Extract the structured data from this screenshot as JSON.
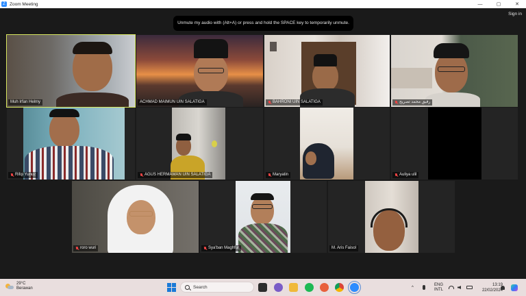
{
  "window": {
    "app_title": "Zoom Meeting",
    "minimize": "—",
    "maximize": "▢",
    "close": "✕"
  },
  "header": {
    "sign_in": "Sign in"
  },
  "notification": {
    "message": "Unmute my audio with (Alt+A) or press and hold the SPACE key to temporarily unmute."
  },
  "participants": [
    {
      "name": "Muh Irfan Helmy",
      "muted": false,
      "active_speaker": true
    },
    {
      "name": "ACHMAD MAIMUN UIN SALATIGA",
      "muted": false,
      "active_speaker": false
    },
    {
      "name": "BAHRONI UIN SALATIGA",
      "muted": true,
      "active_speaker": false
    },
    {
      "name": "رفيق محمد تصريح",
      "muted": true,
      "active_speaker": false
    },
    {
      "name": "Rifqi Yunuz",
      "muted": true,
      "active_speaker": false
    },
    {
      "name": "AGUS HERMAWAN UIN SALATIGA",
      "muted": true,
      "active_speaker": false
    },
    {
      "name": "Maryatin",
      "muted": true,
      "active_speaker": false
    },
    {
      "name": "Auliya ulil",
      "muted": true,
      "active_speaker": false
    },
    {
      "name": "roro wuri",
      "muted": true,
      "active_speaker": false
    },
    {
      "name": "Sya'ban Maghfur",
      "muted": true,
      "active_speaker": false
    },
    {
      "name": "M. Aris Faisol",
      "muted": true,
      "active_speaker": false
    }
  ],
  "taskbar": {
    "weather_temp": "29°C",
    "weather_desc": "Berawan",
    "search_placeholder": "Search",
    "language_primary": "ENG",
    "language_secondary": "INTL",
    "time": "13:19",
    "date": "22/02/2024",
    "tray_chevron": "^"
  },
  "colors": {
    "active_border": "#d9e85f",
    "background": "#1a1a1a",
    "muted_icon": "#e44444",
    "zoom_blue": "#2d8cff"
  }
}
